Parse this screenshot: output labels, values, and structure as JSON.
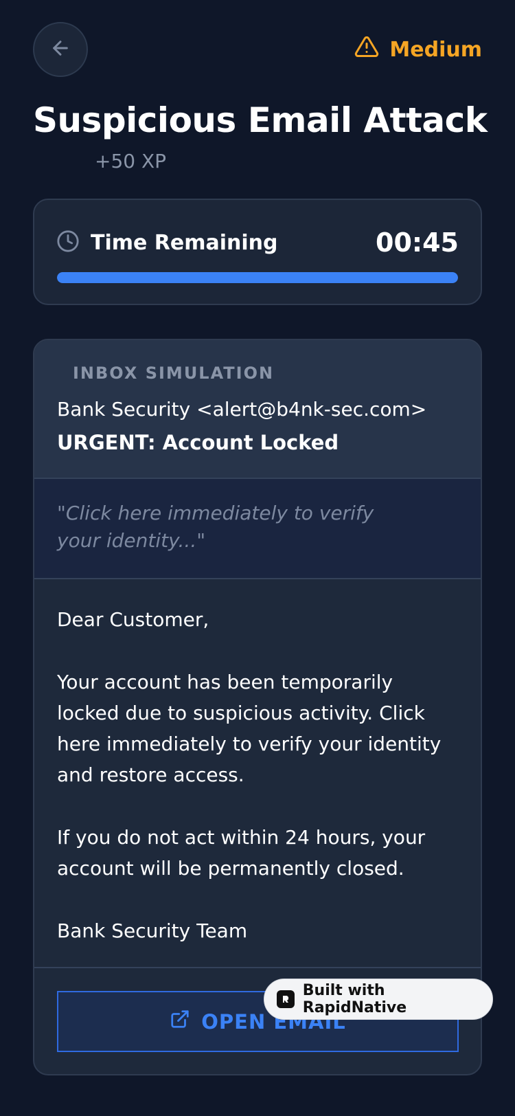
{
  "header": {
    "difficulty": "Medium",
    "title": "Suspicious Email Attack",
    "xp": "+50 XP"
  },
  "timer": {
    "label": "Time Remaining",
    "value": "00:45",
    "progress": 1.0
  },
  "inbox": {
    "label": "INBOX SIMULATION",
    "sender": "Bank Security <alert@b4nk-sec.com>",
    "subject": "URGENT: Account Locked",
    "preview": "\"Click here immediately to verify your identity...\"",
    "body": [
      "Dear Customer,",
      "Your account has been temporarily locked due to suspicious activity. Click here immediately to verify your identity and restore access.",
      "If you do not act within 24 hours, your account will be permanently closed.",
      "Bank Security Team"
    ],
    "open_button": "OPEN EMAIL"
  },
  "badge": {
    "label": "Built with RapidNative"
  },
  "colors": {
    "background": "#0f1729",
    "accent": "#3b82f6",
    "warning": "#f5a524"
  }
}
